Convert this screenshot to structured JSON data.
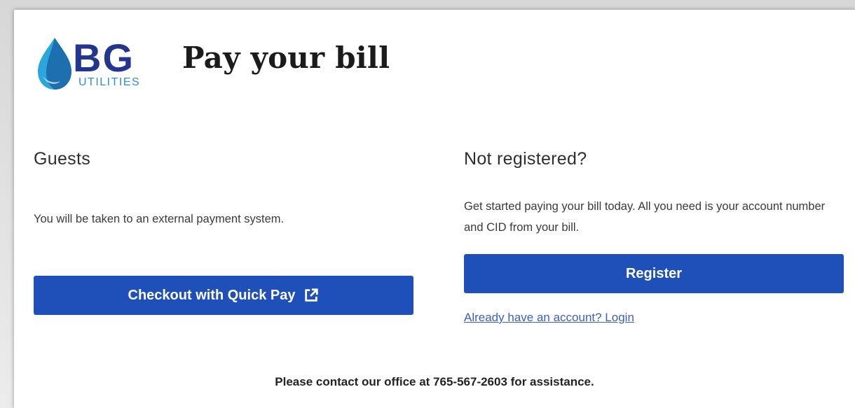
{
  "brand": {
    "logo_letters": "BG",
    "logo_subtitle": "UTILITIES",
    "colors": {
      "drop_light": "#2aa6dc",
      "drop_dark": "#1d6fb0",
      "letters": "#23368f",
      "subtitle": "#2b8fcf"
    }
  },
  "header": {
    "title": "Pay your bill"
  },
  "guests": {
    "heading": "Guests",
    "description": "You will be taken to an external payment system.",
    "quickpay_label": "Checkout with Quick Pay",
    "quickpay_icon": "external-link-icon"
  },
  "register": {
    "heading": "Not registered?",
    "description": "Get started paying your bill today. All you need is your account number and CID from your bill.",
    "register_label": "Register",
    "login_link": "Already have an account? Login"
  },
  "footer": {
    "contact": "Please contact our office at 765-567-2603 for assistance."
  },
  "theme": {
    "button_bg": "#1f4fb8",
    "link_color": "#3a5fc0"
  }
}
